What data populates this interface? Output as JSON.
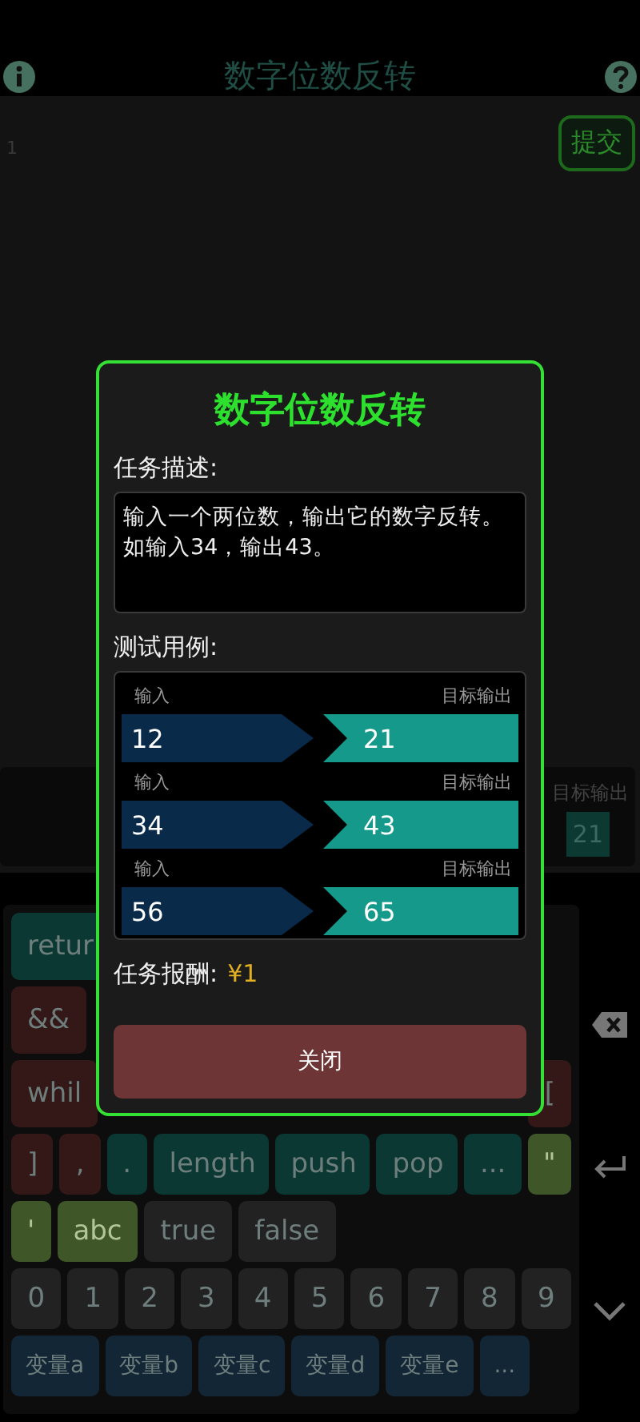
{
  "header": {
    "title": "数字位数反转"
  },
  "editor": {
    "line_numbers": [
      "1"
    ],
    "submit_button": "提交"
  },
  "test_panel": {
    "output_label": "目标输出",
    "output_value": "21"
  },
  "keyboard": {
    "rows": [
      {
        "left": [
          {
            "label": "retur",
            "kind": "keyword"
          }
        ],
        "right": []
      },
      {
        "left": [
          {
            "label": "&&",
            "kind": "operator"
          }
        ],
        "right": []
      },
      {
        "left": [
          {
            "label": "whil",
            "kind": "operator"
          }
        ],
        "right": [
          {
            "label": "[",
            "kind": "operator"
          }
        ]
      },
      {
        "left": [
          {
            "label": "]",
            "kind": "operator"
          },
          {
            "label": ",",
            "kind": "operator"
          },
          {
            "label": ".",
            "kind": "method"
          },
          {
            "label": "length",
            "kind": "method"
          },
          {
            "label": "push",
            "kind": "method"
          },
          {
            "label": "pop",
            "kind": "method"
          },
          {
            "label": "...",
            "kind": "method"
          },
          {
            "label": "\"",
            "kind": "string"
          }
        ],
        "right": []
      },
      {
        "left": [
          {
            "label": "'",
            "kind": "string"
          },
          {
            "label": "abc",
            "kind": "string"
          },
          {
            "label": "true",
            "kind": "literal"
          },
          {
            "label": "false",
            "kind": "literal"
          }
        ],
        "right": []
      },
      {
        "left": [
          {
            "label": "0",
            "kind": "digit"
          },
          {
            "label": "1",
            "kind": "digit"
          },
          {
            "label": "2",
            "kind": "digit"
          },
          {
            "label": "3",
            "kind": "digit"
          },
          {
            "label": "4",
            "kind": "digit"
          },
          {
            "label": "5",
            "kind": "digit"
          },
          {
            "label": "6",
            "kind": "digit"
          },
          {
            "label": "7",
            "kind": "digit"
          },
          {
            "label": "8",
            "kind": "digit"
          },
          {
            "label": "9",
            "kind": "digit"
          }
        ],
        "right": []
      },
      {
        "left": [
          {
            "label": "变量a",
            "kind": "variable"
          },
          {
            "label": "变量b",
            "kind": "variable"
          },
          {
            "label": "变量c",
            "kind": "variable"
          },
          {
            "label": "变量d",
            "kind": "variable"
          },
          {
            "label": "变量e",
            "kind": "variable"
          },
          {
            "label": "...",
            "kind": "variable"
          }
        ],
        "right": []
      }
    ]
  },
  "dialog": {
    "title": "数字位数反转",
    "description_label": "任务描述:",
    "description": "输入一个两位数，输出它的数字反转。如输入34，输出43。",
    "tests_label": "测试用例:",
    "tests": [
      {
        "input_label": "输入",
        "output_label": "目标输出",
        "input": "12",
        "output": "21"
      },
      {
        "input_label": "输入",
        "output_label": "目标输出",
        "input": "34",
        "output": "43"
      },
      {
        "input_label": "输入",
        "output_label": "目标输出",
        "input": "56",
        "output": "65"
      }
    ],
    "reward_label": "任务报酬:",
    "reward": "¥1",
    "close_button": "关闭"
  }
}
